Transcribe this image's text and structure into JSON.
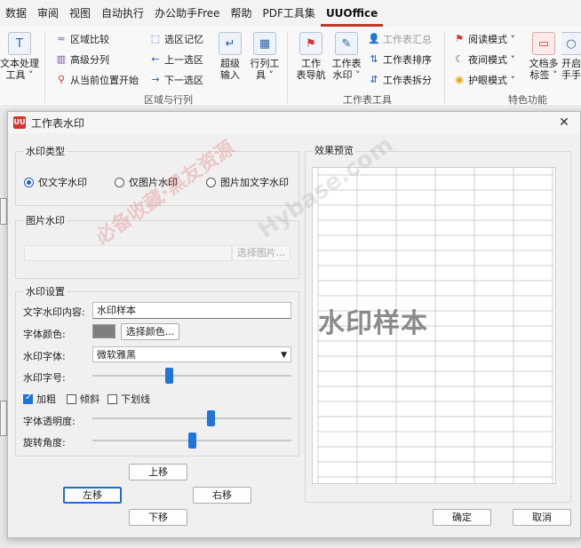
{
  "menubar": {
    "items": [
      {
        "label": "数据",
        "active": false
      },
      {
        "label": "审阅",
        "active": false
      },
      {
        "label": "视图",
        "active": false
      },
      {
        "label": "自动执行",
        "active": false
      },
      {
        "label": "办公助手Free",
        "active": false
      },
      {
        "label": "帮助",
        "active": false
      },
      {
        "label": "PDF工具集",
        "active": false
      },
      {
        "label": "UUOffice",
        "active": true
      }
    ]
  },
  "ribbon": {
    "text_tool": {
      "label1": "文本处理",
      "label2": "工具 ˅"
    },
    "region_compare": "区域比较",
    "advanced_split": "高级分列",
    "from_current": "从当前位置开始",
    "select_memory": "选区记忆",
    "prev_select": "上一选区",
    "next_select": "下一选区",
    "super_input": {
      "label1": "超级",
      "label2": "输入"
    },
    "row_col_tool": {
      "label1": "行列工",
      "label2": "具 ˅"
    },
    "group_region_label": "区域与行列",
    "sheet_nav": {
      "label1": "工作",
      "label2": "表导航"
    },
    "sheet_watermark": {
      "label1": "工作表",
      "label2": "水印 ˅"
    },
    "sheet_summary": "工作表汇总",
    "sheet_sort": "工作表排序",
    "sheet_split": "工作表拆分",
    "group_sheet_label": "工作表工具",
    "read_mode": "阅读模式 ˅",
    "night_mode": "夜间模式 ˅",
    "eye_mode": "护眼模式 ˅",
    "doc_tabs": {
      "label1": "文档多",
      "label2": "标签 ˅"
    },
    "open_other": {
      "label1": "开启",
      "label2": "手手"
    },
    "group_special_label": "特色功能"
  },
  "dialog": {
    "title": "工作表水印",
    "logo_text": "UU",
    "watermark_type": {
      "title": "水印类型",
      "options": [
        {
          "label": "仅文字水印",
          "selected": true
        },
        {
          "label": "仅图片水印",
          "selected": false
        },
        {
          "label": "图片加文字水印",
          "selected": false
        }
      ]
    },
    "image_watermark": {
      "title": "图片水印",
      "select_button": "选择图片..."
    },
    "settings": {
      "title": "水印设置",
      "text_label": "文字水印内容:",
      "text_value": "水印样本",
      "color_label": "字体颜色:",
      "color_value": "#7f7f7f",
      "color_button": "选择颜色...",
      "font_label": "水印字体:",
      "font_value": "微软雅黑",
      "size_label": "水印字号:",
      "size_slider": 0.38,
      "bold": {
        "label": "加粗",
        "checked": true
      },
      "italic": {
        "label": "倾斜",
        "checked": false
      },
      "underline": {
        "label": "下划线",
        "checked": false
      },
      "opacity_label": "字体透明度:",
      "opacity_slider": 0.6,
      "rotation_label": "旋转角度:",
      "rotation_slider": 0.5
    },
    "move": {
      "up": "上移",
      "left": "左移",
      "right": "右移",
      "down": "下移"
    },
    "preview": {
      "title": "效果预览",
      "text": "水印样本"
    },
    "ok": "确定",
    "cancel": "取消"
  },
  "overlay_watermarks": {
    "red": "必备收藏·黑友资源",
    "grey": "Hybase.com"
  },
  "colors": {
    "accent": "#1f73d9",
    "brand_red": "#d6342c"
  }
}
